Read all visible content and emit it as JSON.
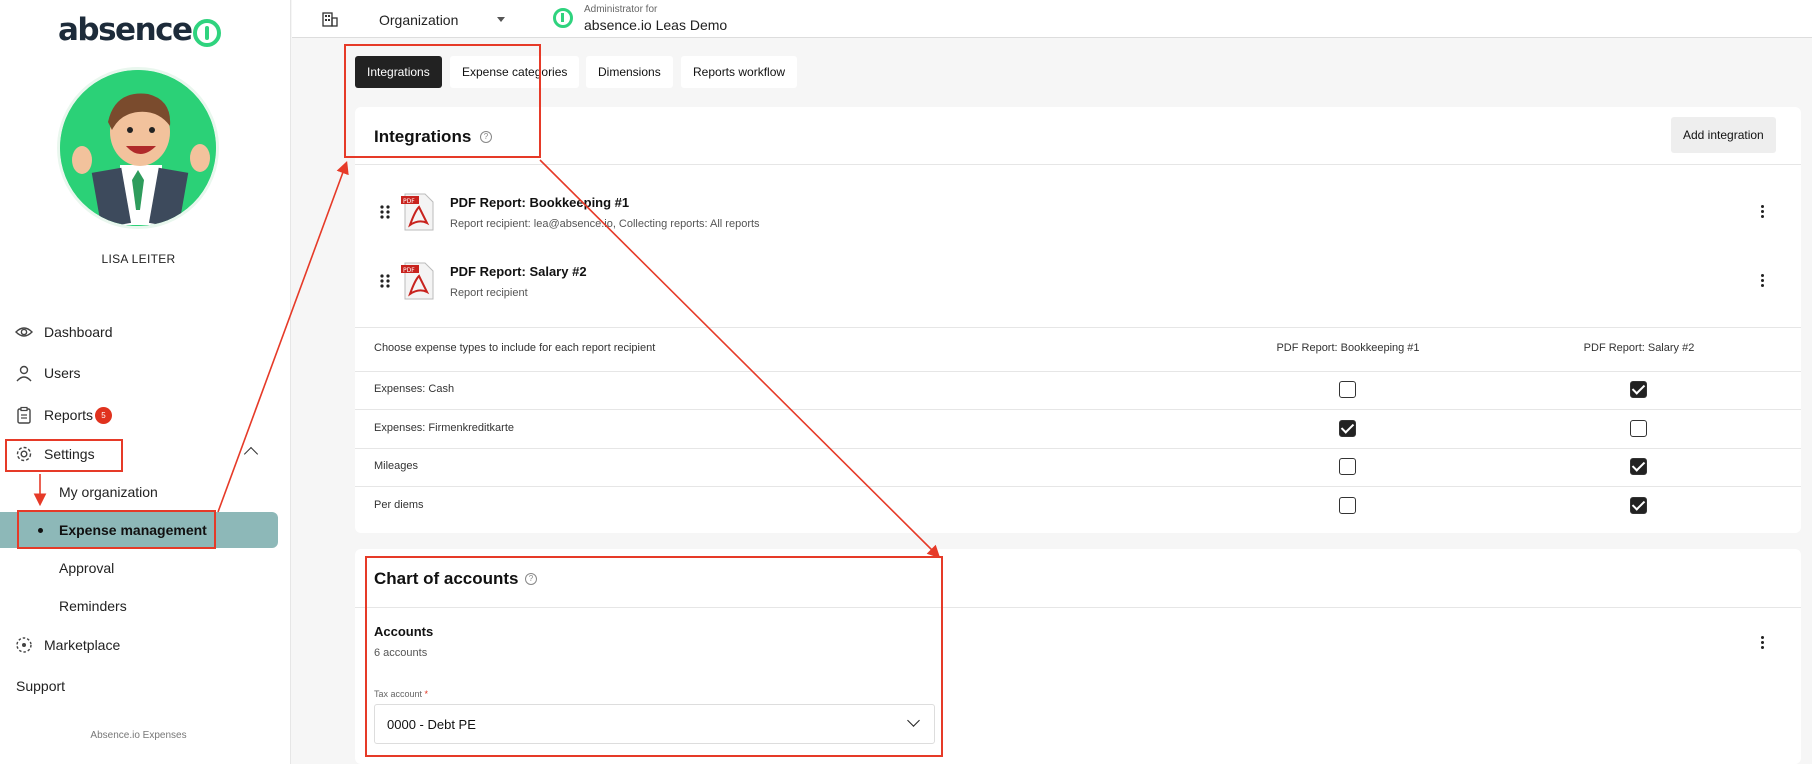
{
  "brand": {
    "logo_text": "absence",
    "footer": "Absence.io Expenses"
  },
  "user": {
    "name": "LISA LEITER"
  },
  "nav": {
    "dashboard": "Dashboard",
    "users": "Users",
    "reports": "Reports",
    "reports_badge": "5",
    "settings": "Settings",
    "settings_sub": [
      "My organization",
      "Expense management",
      "Approval",
      "Reminders"
    ],
    "marketplace": "Marketplace",
    "support": "Support"
  },
  "topbar": {
    "org_selector": "Organization",
    "admin_caption": "Administrator for",
    "admin_org": "absence.io Leas Demo"
  },
  "tabs": [
    "Integrations",
    "Expense categories",
    "Dimensions",
    "Reports workflow"
  ],
  "integrations": {
    "title": "Integrations",
    "add_button": "Add integration",
    "items": [
      {
        "title": "PDF Report: Bookkeeping #1",
        "subtitle": "Report recipient: lea@absence.io, Collecting reports: All reports"
      },
      {
        "title": "PDF Report: Salary #2",
        "subtitle": "Report recipient"
      }
    ],
    "matrix_caption": "Choose expense types to include for each report recipient",
    "columns": [
      "PDF Report: Bookkeeping #1",
      "PDF Report: Salary #2"
    ],
    "rows": [
      {
        "label": "Expenses: Cash",
        "checked": [
          false,
          true
        ]
      },
      {
        "label": "Expenses: Firmenkreditkarte",
        "checked": [
          true,
          false
        ]
      },
      {
        "label": "Mileages",
        "checked": [
          false,
          true
        ]
      },
      {
        "label": "Per diems",
        "checked": [
          false,
          true
        ]
      }
    ]
  },
  "chart_of_accounts": {
    "title": "Chart of accounts",
    "accounts_heading": "Accounts",
    "accounts_count": "6 accounts",
    "tax_account_label": "Tax account",
    "required_mark": "*",
    "tax_account_value": "0000 - Debt PE"
  },
  "colors": {
    "accent_green": "#2fd37e",
    "active_nav": "#8db8b8",
    "annotation_red": "#e63a28",
    "badge_red": "#e0321e"
  }
}
